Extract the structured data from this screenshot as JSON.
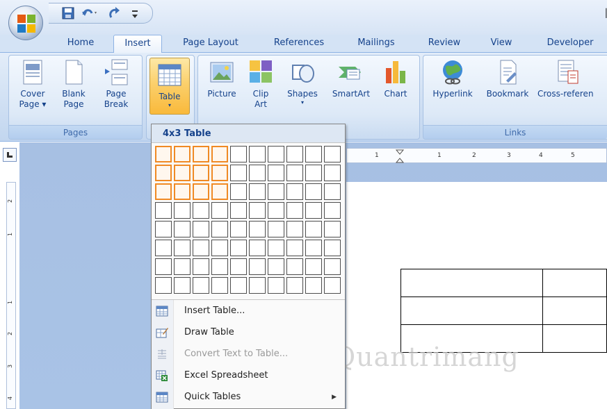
{
  "quick_access": {
    "items": [
      "save-icon",
      "undo-icon",
      "redo-icon",
      "customize-icon"
    ]
  },
  "tabs": [
    {
      "label": "Home",
      "active": false
    },
    {
      "label": "Insert",
      "active": true
    },
    {
      "label": "Page Layout",
      "active": false
    },
    {
      "label": "References",
      "active": false
    },
    {
      "label": "Mailings",
      "active": false
    },
    {
      "label": "Review",
      "active": false
    },
    {
      "label": "View",
      "active": false
    },
    {
      "label": "Developer",
      "active": false
    }
  ],
  "ribbon": {
    "pages": {
      "label": "Pages",
      "cover_page": {
        "line1": "Cover",
        "line2": "Page ▾"
      },
      "blank_page": {
        "line1": "Blank",
        "line2": "Page"
      },
      "page_break": {
        "line1": "Page",
        "line2": "Break"
      }
    },
    "tables": {
      "table": {
        "line1": "Table",
        "arrow": "▾"
      }
    },
    "illustrations": {
      "picture": {
        "line1": "Picture"
      },
      "clip_art": {
        "line1": "Clip",
        "line2": "Art"
      },
      "shapes": {
        "line1": "Shapes",
        "arrow": "▾"
      },
      "smartart": {
        "line1": "SmartArt"
      },
      "chart": {
        "line1": "Chart"
      }
    },
    "links": {
      "label": "Links",
      "hyperlink": {
        "line1": "Hyperlink"
      },
      "bookmark": {
        "line1": "Bookmark"
      },
      "cross_reference": {
        "line1": "Cross-referen"
      }
    }
  },
  "ruler": {
    "horizontal": [
      "1",
      "1",
      "2",
      "3",
      "4",
      "5"
    ],
    "vertical": [
      "2",
      "1",
      "1",
      "2",
      "3",
      "4"
    ]
  },
  "table_menu": {
    "header": "4x3 Table",
    "grid": {
      "columns": 10,
      "rows": 8,
      "selected_columns": 4,
      "selected_rows": 3
    },
    "items": [
      {
        "label": "Insert Table...",
        "icon": "insert-table-icon",
        "enabled": true,
        "submenu": false
      },
      {
        "label": "Draw Table",
        "icon": "draw-table-icon",
        "enabled": true,
        "submenu": false
      },
      {
        "label": "Convert Text to Table...",
        "icon": "convert-text-icon",
        "enabled": false,
        "submenu": false
      },
      {
        "label": "Excel Spreadsheet",
        "icon": "excel-spreadsheet-icon",
        "enabled": true,
        "submenu": false
      },
      {
        "label": "Quick Tables",
        "icon": "quick-tables-icon",
        "enabled": true,
        "submenu": true
      }
    ]
  },
  "document": {
    "table": {
      "rows": 3,
      "columns": 2
    }
  },
  "watermark": "Quantrimang",
  "colors": {
    "accent": "#f08a24",
    "ribbon_text": "#15428b",
    "pressed_button": "#fbd06c"
  }
}
